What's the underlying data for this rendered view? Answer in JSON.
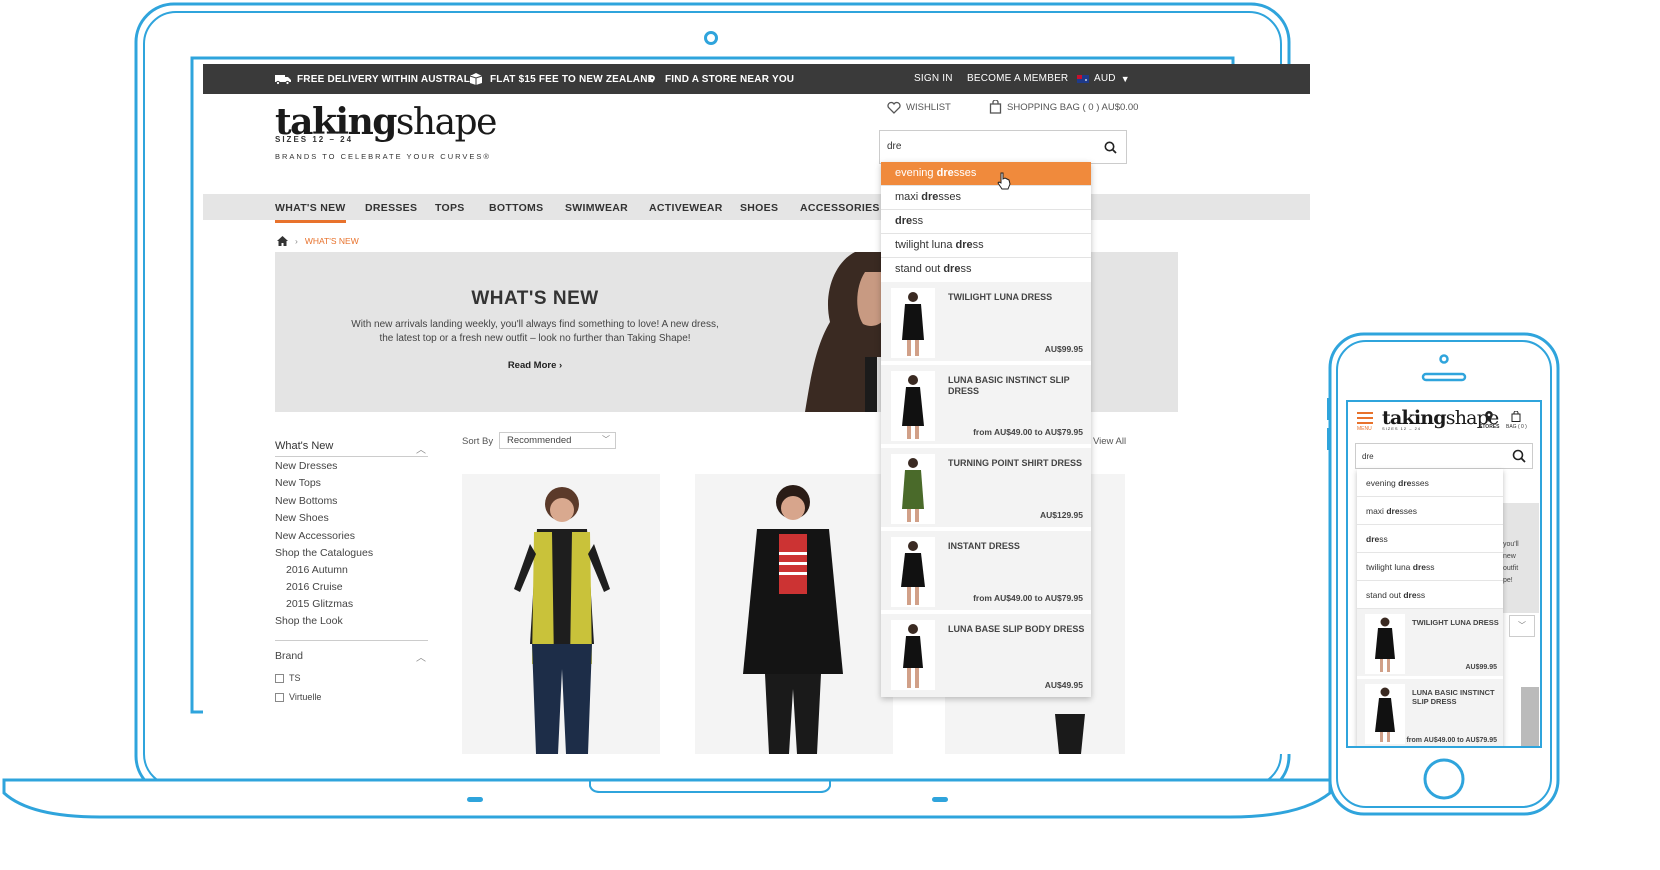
{
  "colors": {
    "frame": "#2fa4dc",
    "accent": "#e8722c",
    "topbar": "#3a3a3a",
    "highlight": "#f08a3c"
  },
  "topbar": {
    "delivery": "FREE DELIVERY WITHIN AUSTRALIA",
    "flat_fee": "FLAT $15 FEE TO NEW ZEALAND",
    "find_store": "FIND A STORE NEAR YOU",
    "sign_in": "SIGN IN",
    "become_member": "BECOME A MEMBER",
    "currency": "AUD"
  },
  "header": {
    "logo_taking": "taking",
    "logo_shape": "shape",
    "logo_sizes": "SIZES 12 – 24",
    "logo_tagline": "BRANDS TO CELEBRATE YOUR CURVES®",
    "wishlist": "WISHLIST",
    "bag": "SHOPPING BAG ( 0 ) AU$0.00",
    "search_value": "dre"
  },
  "nav": [
    "WHAT'S NEW",
    "DRESSES",
    "TOPS",
    "BOTTOMS",
    "SWIMWEAR",
    "ACTIVEWEAR",
    "SHOES",
    "ACCESSORIES"
  ],
  "breadcrumb": {
    "sep": "›",
    "current": "WHAT'S NEW"
  },
  "hero": {
    "title": "WHAT'S NEW",
    "line1": "With new arrivals landing weekly, you'll always find something to love! A new dress,",
    "line2": "the latest top or a fresh new outfit – look no further than Taking Shape!",
    "read_more": "Read More ›"
  },
  "sidebar": {
    "heading": "What's New",
    "links": [
      "New Dresses",
      "New Tops",
      "New Bottoms",
      "New Shoes",
      "New Accessories",
      "Shop the Catalogues"
    ],
    "sub": [
      "2016 Autumn",
      "2016 Cruise",
      "2015 Glitzmas"
    ],
    "shop_look": "Shop the Look",
    "brand_heading": "Brand",
    "brands": [
      "TS",
      "Virtuelle"
    ]
  },
  "sort": {
    "label": "Sort By",
    "value": "Recommended",
    "view_all": "View All"
  },
  "suggestions": [
    {
      "plain1": "evening ",
      "bold": "dre",
      "plain2": "sses"
    },
    {
      "plain1": "maxi ",
      "bold": "dre",
      "plain2": "sses"
    },
    {
      "plain1": "",
      "bold": "dre",
      "plain2": "ss"
    },
    {
      "plain1": "twilight luna ",
      "bold": "dre",
      "plain2": "ss"
    },
    {
      "plain1": "stand out ",
      "bold": "dre",
      "plain2": "ss"
    }
  ],
  "products": [
    {
      "name": "TWILIGHT LUNA DRESS",
      "price": "AU$99.95"
    },
    {
      "name": "LUNA BASIC INSTINCT SLIP DRESS",
      "price": "from AU$49.00 to AU$79.95"
    },
    {
      "name": "TURNING POINT SHIRT DRESS",
      "price": "AU$129.95"
    },
    {
      "name": "INSTANT DRESS",
      "price": "from AU$49.00 to AU$79.95"
    },
    {
      "name": "LUNA BASE SLIP BODY DRESS",
      "price": "AU$49.95"
    }
  ],
  "phone": {
    "menu": "MENU",
    "stores": "STORES",
    "bag": "BAG ( 0 )",
    "search_value": "dre",
    "hero_fragment": [
      "you'll",
      "new",
      "outfit",
      "pe!"
    ]
  }
}
